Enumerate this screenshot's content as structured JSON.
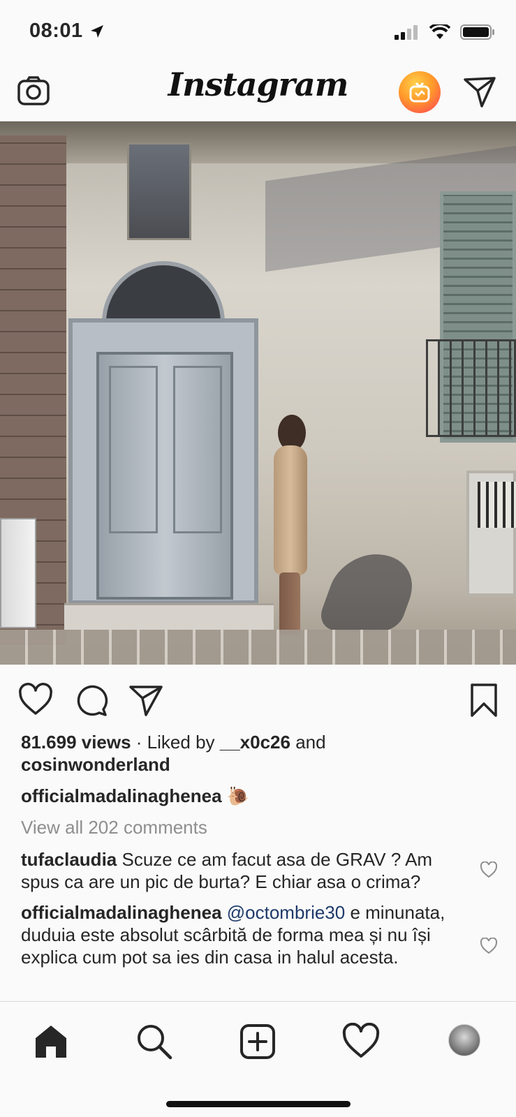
{
  "status_bar": {
    "time": "08:01",
    "icons": [
      "location-arrow-icon",
      "signal-icon",
      "wifi-icon",
      "battery-icon"
    ]
  },
  "header": {
    "logo": "Instagram",
    "icons": [
      "camera-icon",
      "igtv-icon",
      "direct-message-icon"
    ]
  },
  "post": {
    "views": "81.699 views",
    "liked_by_prefix": " · Liked by ",
    "liked_by_user1": "__x0c26",
    "liked_by_and": " and",
    "liked_by_user2": "cosinwonderland",
    "author": "officialmadalinaghenea",
    "caption": " 🐌",
    "view_all_comments": "View all 202 comments",
    "comments": [
      {
        "user": "tufaclaudia",
        "text": " Scuze ce am facut asa de GRAV ? Am spus ca are un pic de burta? E chiar asa o crima?"
      },
      {
        "user": "officialmadalinaghenea",
        "mention": " @octombrie30",
        "text": " e minunata, duduia este absolut scârbită de forma mea și nu își explica cum pot sa ies din casa in halul acesta."
      }
    ]
  },
  "tabbar": {
    "items": [
      "home-icon",
      "search-icon",
      "new-post-icon",
      "activity-heart-icon",
      "profile-avatar"
    ]
  },
  "colors": {
    "background": "#fafafa",
    "text": "#262626",
    "muted": "#8e8e8e",
    "mention": "#1e3a6a",
    "igtv_gradient": [
      "#ffd04a",
      "#ff9a2a",
      "#ff3b58"
    ]
  }
}
